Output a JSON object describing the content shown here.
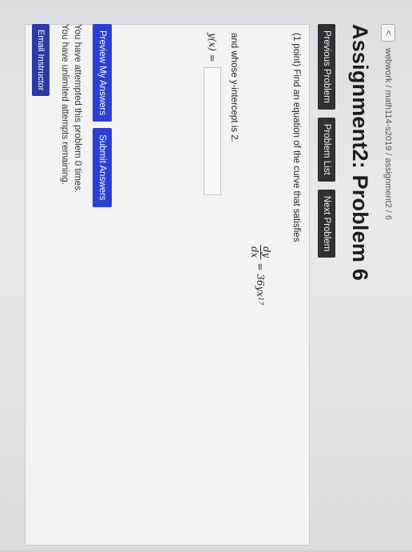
{
  "breadcrumb": {
    "back_glyph": "<",
    "path": "webwork / math114-s2019 / assignment2 / 6"
  },
  "page_title": "Assignment2: Problem 6",
  "nav": {
    "previous": "Previous Problem",
    "list": "Problem List",
    "next": "Next Problem"
  },
  "problem": {
    "prompt": "(1 point) Find an equation of the curve that satisfies",
    "equation": {
      "numerator": "dy",
      "denominator": "dx",
      "rhs": "= 36yx",
      "exponent": "17"
    },
    "intercept_text": "and whose y-intercept is 2.",
    "answer_label": "y(x) =",
    "answer_value": ""
  },
  "actions": {
    "preview": "Preview My Answers",
    "submit": "Submit Answers"
  },
  "status": {
    "attempted": "You have attempted this problem 0 times.",
    "remaining": "You have unlimited attempts remaining."
  },
  "email_button": "Email Instructor",
  "colors": {
    "nav_button": "#2f3136",
    "primary_button": "#2b3fd6",
    "email_button": "#2a3aa8"
  }
}
